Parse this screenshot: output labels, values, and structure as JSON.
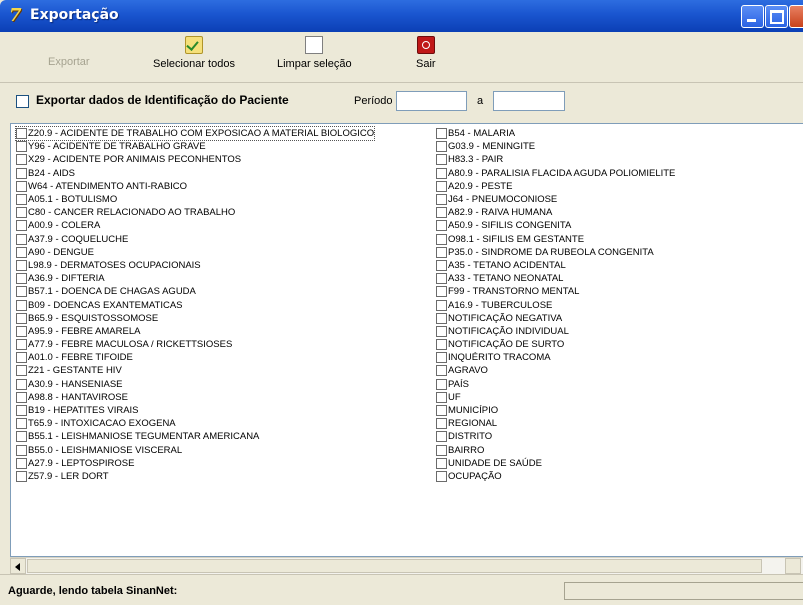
{
  "window": {
    "title": "Exportação"
  },
  "toolbar": {
    "export_label": "Exportar",
    "select_all_label": "Selecionar todos",
    "clear_selection_label": "Limpar seleção",
    "exit_label": "Sair"
  },
  "options": {
    "export_patient_id_label": "Exportar dados de Identificação do Paciente",
    "period_label": "Período",
    "period_to_label": "a",
    "period_from_value": "",
    "period_to_value": ""
  },
  "list": {
    "column1": [
      "Z20.9 - ACIDENTE DE TRABALHO COM EXPOSICAO A MATERIAL BIOLOGICO",
      "Y96 - ACIDENTE DE TRABALHO GRAVE",
      "X29 - ACIDENTE POR ANIMAIS PECONHENTOS",
      "B24 - AIDS",
      "W64 - ATENDIMENTO ANTI-RABICO",
      "A05.1 - BOTULISMO",
      "C80 - CANCER RELACIONADO AO TRABALHO",
      "A00.9 - COLERA",
      "A37.9 - COQUELUCHE",
      "A90 - DENGUE",
      "L98.9 - DERMATOSES OCUPACIONAIS",
      "A36.9 - DIFTERIA",
      "B57.1 - DOENCA DE CHAGAS AGUDA",
      "B09 - DOENCAS EXANTEMATICAS",
      "B65.9 - ESQUISTOSSOMOSE",
      "A95.9 - FEBRE AMARELA",
      "A77.9 - FEBRE MACULOSA / RICKETTSIOSES",
      "A01.0 - FEBRE TIFOIDE",
      "Z21 - GESTANTE HIV",
      "A30.9 - HANSENIASE",
      "A98.8 - HANTAVIROSE",
      "B19 - HEPATITES VIRAIS",
      "T65.9 - INTOXICACAO EXOGENA",
      "B55.1 - LEISHMANIOSE TEGUMENTAR AMERICANA",
      "B55.0 - LEISHMANIOSE VISCERAL",
      "A27.9 - LEPTOSPIROSE",
      "Z57.9 - LER DORT"
    ],
    "column2": [
      "B54 - MALARIA",
      "G03.9 - MENINGITE",
      "H83.3 - PAIR",
      "A80.9 - PARALISIA FLACIDA AGUDA  POLIOMIELITE",
      "A20.9 - PESTE",
      "J64 - PNEUMOCONIOSE",
      "A82.9 - RAIVA HUMANA",
      "A50.9 - SIFILIS CONGENITA",
      "O98.1 - SIFILIS EM GESTANTE",
      "P35.0 - SINDROME DA RUBEOLA CONGENITA",
      "A35 - TETANO ACIDENTAL",
      "A33 - TETANO NEONATAL",
      "F99 - TRANSTORNO MENTAL",
      "A16.9 - TUBERCULOSE",
      "NOTIFICAÇÃO NEGATIVA",
      "NOTIFICAÇÃO INDIVIDUAL",
      "NOTIFICAÇÃO DE SURTO",
      "INQUÉRITO TRACOMA",
      "AGRAVO",
      "PAÍS",
      "UF",
      "MUNICÍPIO",
      "REGIONAL",
      "DISTRITO",
      "BAIRRO",
      "UNIDADE DE SAÚDE",
      "OCUPAÇÃO"
    ]
  },
  "status": {
    "message": "Aguarde, lendo tabela SinanNet:"
  }
}
